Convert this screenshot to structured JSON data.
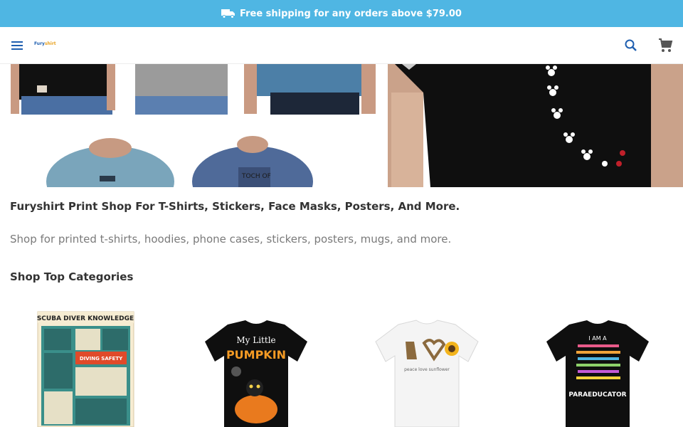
{
  "promo": {
    "icon": "truck-icon",
    "text": "Free shipping for any orders above $79.00",
    "background": "#4fb6e3"
  },
  "header": {
    "menu_icon": "hamburger-menu-icon",
    "logo_text_a": "Fury",
    "logo_text_b": "shirt",
    "search_icon": "search-icon",
    "cart_icon": "cart-icon"
  },
  "hero": {
    "collage_image": "men-in-t-shirts-collage",
    "main_image": "black-t-shirt-closeup"
  },
  "intro": {
    "headline": "Furyshirt Print Shop For T-Shirts, Stickers, Face Masks, Posters, And More.",
    "subline": "Shop for printed t-shirts, hoodies, phone cases, stickers, posters, mugs, and more."
  },
  "categories": {
    "title": "Shop Top Categories",
    "items": [
      {
        "image": "scuba-diver-knowledge-poster",
        "poster_title": "SCUBA DIVER KNOWLEDGE",
        "poster_subtitle": "DIVING SAFETY"
      },
      {
        "image": "my-little-pumpkin-black-tshirt",
        "line1": "My Little",
        "line2": "PUMPKIN"
      },
      {
        "image": "peace-love-sunflower-white-tshirt",
        "line1": "peace love sunflower"
      },
      {
        "image": "paraeducator-black-tshirt",
        "line1": "I AM A",
        "line2": "PARAEDUCATOR"
      }
    ]
  }
}
